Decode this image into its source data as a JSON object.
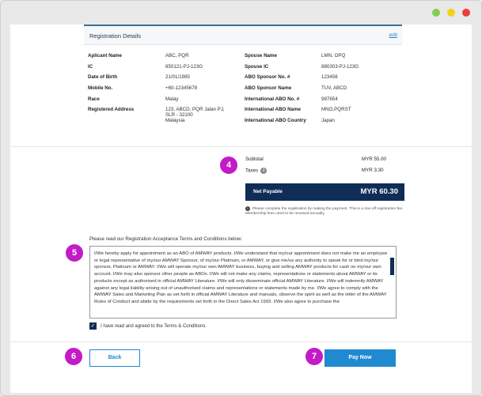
{
  "colors": {
    "accent_navy": "#0f2d57",
    "link_blue": "#1f8ad0",
    "step_marker": "#c41ac8",
    "dot_green": "#7fcf4f",
    "dot_yellow": "#f4d21a",
    "dot_red": "#ef3b36"
  },
  "window": {
    "controls": [
      "green-dot",
      "yellow-dot",
      "red-dot"
    ]
  },
  "registration": {
    "title": "Registration Details",
    "edit_label": "edit",
    "left": [
      {
        "label": "Aplicant Name",
        "value": "ABC, PQR"
      },
      {
        "label": "IC",
        "value": "850121-PJ-123G"
      },
      {
        "label": "Date of Birth",
        "value": "21/01/1985"
      },
      {
        "label": "Mobile No.",
        "value": "+60-12345678"
      },
      {
        "label": "Race",
        "value": "Malay"
      },
      {
        "label": "Registered Address",
        "value_lines": [
          "123, ABCD, PQR Jalan PJ,",
          "SLR - 32100",
          "Malaysia"
        ]
      }
    ],
    "right": [
      {
        "label": "Spouse Name",
        "value": "LMN, OPQ"
      },
      {
        "label": "Spouse IC",
        "value": "880303-PJ-123G"
      },
      {
        "label": "ABO Sponsor No. #",
        "value": "123456"
      },
      {
        "label": "ABO Sponsor Name",
        "value": "TUV, ABCD"
      },
      {
        "label": "International ABO No. #",
        "value": "987654"
      },
      {
        "label": "International ABO Name",
        "value": "MNO,PQRST"
      },
      {
        "label": "International ABO Country",
        "value": "Japan"
      }
    ]
  },
  "summary": {
    "subtotal_label": "Subtotal",
    "subtotal_value": "MYR 55.00",
    "taxes_label": "Taxes",
    "taxes_icon": "info-icon",
    "taxes_value": "MYR 3.30",
    "net_label": "Net Payable",
    "net_value": "MYR 60.30",
    "note": "Please complete the registration by making the payment. This is a one-off registration fee. Membership fees need to be renewed annually."
  },
  "terms": {
    "heading": "Please read our Registration Acceptance Terms and Conditions below:",
    "text": "I/We hereby apply for appointment as an ABO of AMWAY products. I/We understand that my/our appointment does not make me an employee or legal representative of my/our AMWAY Sponsor, of my/our Platinum, or AMWAY, or give me/us any authority to speak for or bind my/our sponsor, Platinum or AMWAY. I/We will operate my/our own AMWAY business, buying and selling AMWAY products for cash on my/our own account. I/We may also sponsor other people as ABOs. I/We will not make any claims, representations or statements about AMWAY or its products except as authorised in official AMWAY Literature. I/We will only disseminate official AMWAY Literature. I/We will indemnify AMWAY against any legal liability arising out of unauthorised claims and representations or statements made by me. I/We agree to comply with the AMWAY Sales and Marketing Plan as set forth in official AMWAY Literature and manuals, observe the spirit as well as the letter of the AMWAY Rules of Conduct and abide by the requirements set forth in the Direct Sales Act 1993. I/We also agree to purchase the",
    "agree_label": "I have read and agreed to the Terms & Conditions.",
    "agree_checked": true
  },
  "buttons": {
    "back": "Back",
    "pay": "Pay Now"
  },
  "steps": [
    "4",
    "5",
    "6",
    "7"
  ]
}
